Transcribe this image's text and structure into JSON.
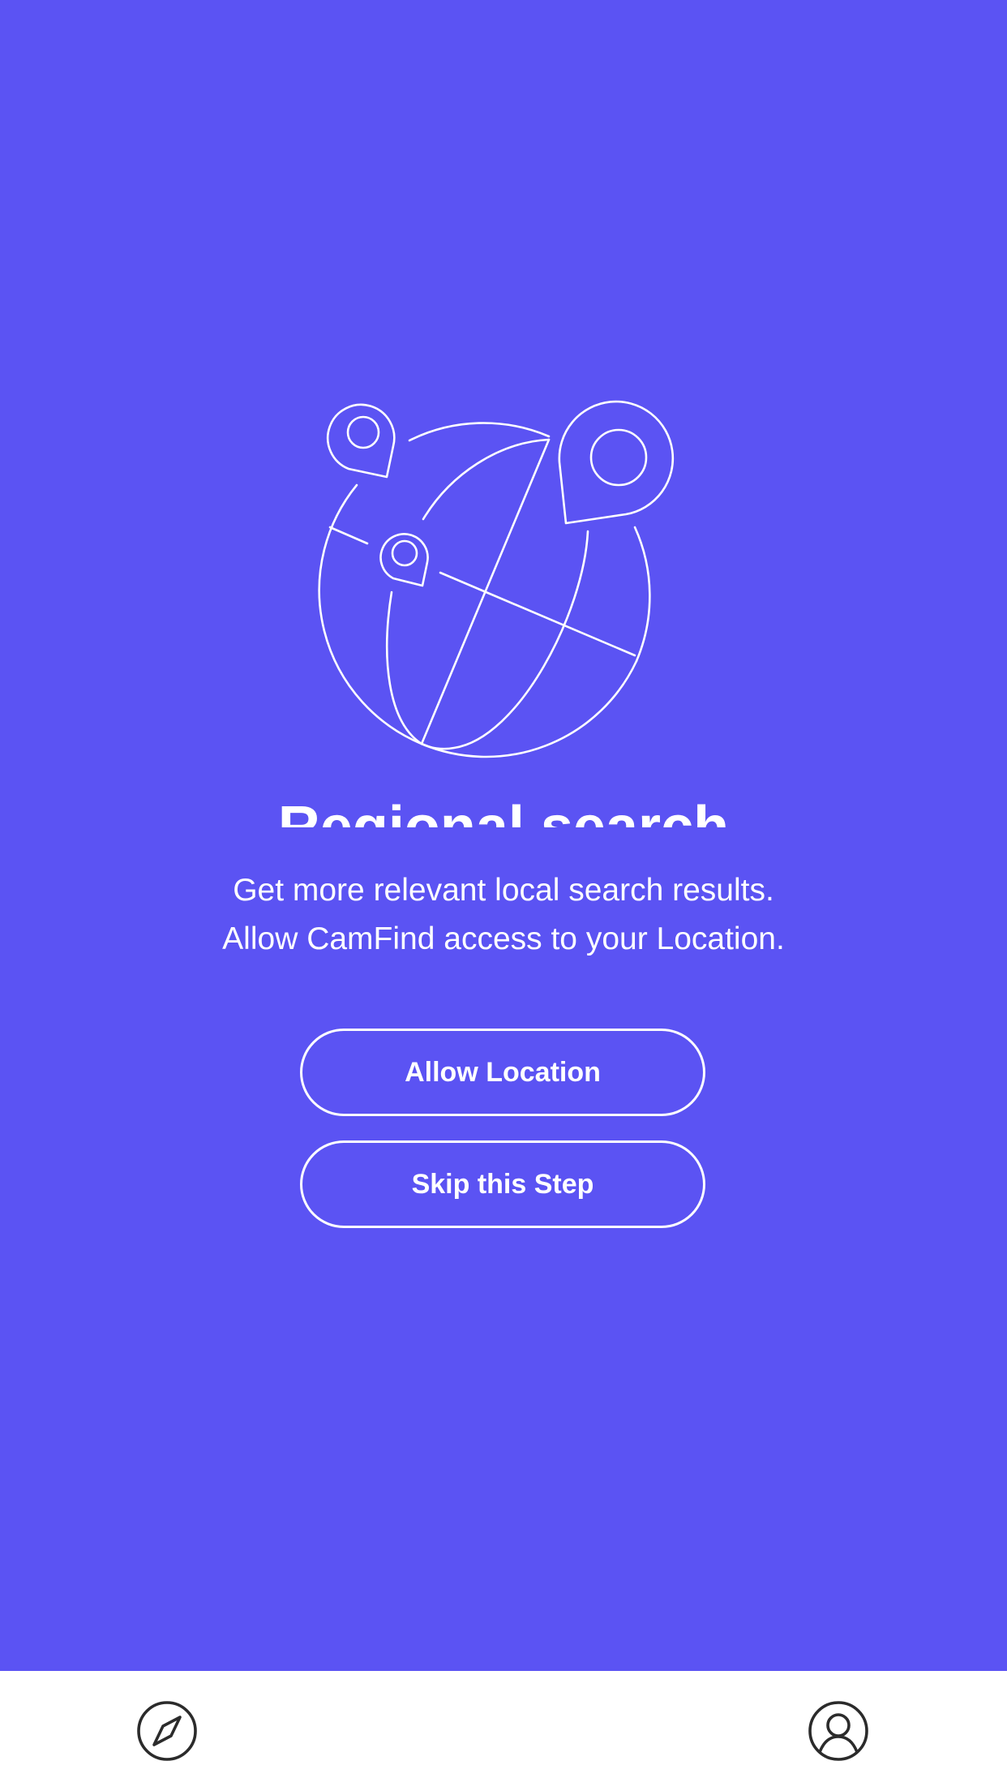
{
  "onboarding": {
    "illustration_icon": "globe-with-location-pins-icon",
    "title": "Regional search",
    "description_lines": [
      "Get more relevant local search results.",
      "Allow CamFind access to your Location."
    ],
    "allow_button_label": "Allow Location",
    "skip_button_label": "Skip this Step"
  },
  "tabbar": {
    "items": [
      {
        "icon": "compass-icon"
      },
      {
        "icon": "profile-icon"
      }
    ]
  },
  "colors": {
    "background": "#5b53f3",
    "foreground": "#ffffff",
    "tabbar_background": "#ffffff",
    "tabbar_icon": "#2b2b2b"
  }
}
